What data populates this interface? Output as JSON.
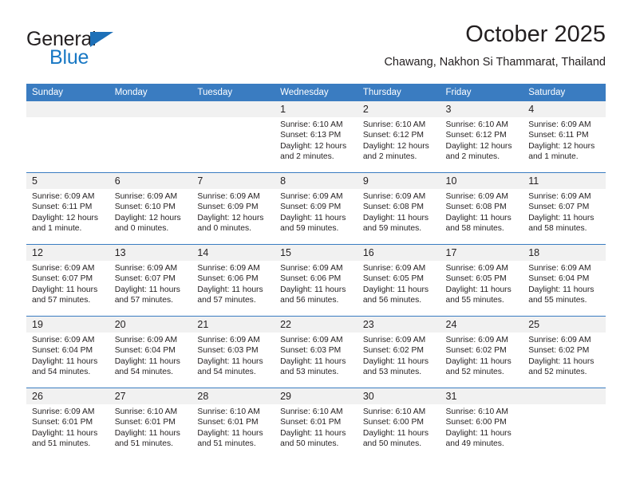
{
  "brand": {
    "name_part1": "General",
    "name_part2": "Blue",
    "triangle_color": "#1d70b8",
    "blue_color": "#1878c4"
  },
  "header": {
    "title": "October 2025",
    "subtitle": "Chawang, Nakhon Si Thammarat, Thailand",
    "header_bg": "#3a7cc1",
    "daynum_bg": "#f1f1f1"
  },
  "weekday_headers": [
    "Sunday",
    "Monday",
    "Tuesday",
    "Wednesday",
    "Thursday",
    "Friday",
    "Saturday"
  ],
  "labels": {
    "sunrise_prefix": "Sunrise:",
    "sunset_prefix": "Sunset:",
    "daylight_prefix": "Daylight:"
  },
  "weeks": [
    [
      {
        "day": "",
        "blank": true
      },
      {
        "day": "",
        "blank": true
      },
      {
        "day": "",
        "blank": true
      },
      {
        "day": "1",
        "sunrise": "Sunrise: 6:10 AM",
        "sunset": "Sunset: 6:13 PM",
        "daylight1": "Daylight: 12 hours",
        "daylight2": "and 2 minutes."
      },
      {
        "day": "2",
        "sunrise": "Sunrise: 6:10 AM",
        "sunset": "Sunset: 6:12 PM",
        "daylight1": "Daylight: 12 hours",
        "daylight2": "and 2 minutes."
      },
      {
        "day": "3",
        "sunrise": "Sunrise: 6:10 AM",
        "sunset": "Sunset: 6:12 PM",
        "daylight1": "Daylight: 12 hours",
        "daylight2": "and 2 minutes."
      },
      {
        "day": "4",
        "sunrise": "Sunrise: 6:09 AM",
        "sunset": "Sunset: 6:11 PM",
        "daylight1": "Daylight: 12 hours",
        "daylight2": "and 1 minute."
      }
    ],
    [
      {
        "day": "5",
        "sunrise": "Sunrise: 6:09 AM",
        "sunset": "Sunset: 6:11 PM",
        "daylight1": "Daylight: 12 hours",
        "daylight2": "and 1 minute."
      },
      {
        "day": "6",
        "sunrise": "Sunrise: 6:09 AM",
        "sunset": "Sunset: 6:10 PM",
        "daylight1": "Daylight: 12 hours",
        "daylight2": "and 0 minutes."
      },
      {
        "day": "7",
        "sunrise": "Sunrise: 6:09 AM",
        "sunset": "Sunset: 6:09 PM",
        "daylight1": "Daylight: 12 hours",
        "daylight2": "and 0 minutes."
      },
      {
        "day": "8",
        "sunrise": "Sunrise: 6:09 AM",
        "sunset": "Sunset: 6:09 PM",
        "daylight1": "Daylight: 11 hours",
        "daylight2": "and 59 minutes."
      },
      {
        "day": "9",
        "sunrise": "Sunrise: 6:09 AM",
        "sunset": "Sunset: 6:08 PM",
        "daylight1": "Daylight: 11 hours",
        "daylight2": "and 59 minutes."
      },
      {
        "day": "10",
        "sunrise": "Sunrise: 6:09 AM",
        "sunset": "Sunset: 6:08 PM",
        "daylight1": "Daylight: 11 hours",
        "daylight2": "and 58 minutes."
      },
      {
        "day": "11",
        "sunrise": "Sunrise: 6:09 AM",
        "sunset": "Sunset: 6:07 PM",
        "daylight1": "Daylight: 11 hours",
        "daylight2": "and 58 minutes."
      }
    ],
    [
      {
        "day": "12",
        "sunrise": "Sunrise: 6:09 AM",
        "sunset": "Sunset: 6:07 PM",
        "daylight1": "Daylight: 11 hours",
        "daylight2": "and 57 minutes."
      },
      {
        "day": "13",
        "sunrise": "Sunrise: 6:09 AM",
        "sunset": "Sunset: 6:07 PM",
        "daylight1": "Daylight: 11 hours",
        "daylight2": "and 57 minutes."
      },
      {
        "day": "14",
        "sunrise": "Sunrise: 6:09 AM",
        "sunset": "Sunset: 6:06 PM",
        "daylight1": "Daylight: 11 hours",
        "daylight2": "and 57 minutes."
      },
      {
        "day": "15",
        "sunrise": "Sunrise: 6:09 AM",
        "sunset": "Sunset: 6:06 PM",
        "daylight1": "Daylight: 11 hours",
        "daylight2": "and 56 minutes."
      },
      {
        "day": "16",
        "sunrise": "Sunrise: 6:09 AM",
        "sunset": "Sunset: 6:05 PM",
        "daylight1": "Daylight: 11 hours",
        "daylight2": "and 56 minutes."
      },
      {
        "day": "17",
        "sunrise": "Sunrise: 6:09 AM",
        "sunset": "Sunset: 6:05 PM",
        "daylight1": "Daylight: 11 hours",
        "daylight2": "and 55 minutes."
      },
      {
        "day": "18",
        "sunrise": "Sunrise: 6:09 AM",
        "sunset": "Sunset: 6:04 PM",
        "daylight1": "Daylight: 11 hours",
        "daylight2": "and 55 minutes."
      }
    ],
    [
      {
        "day": "19",
        "sunrise": "Sunrise: 6:09 AM",
        "sunset": "Sunset: 6:04 PM",
        "daylight1": "Daylight: 11 hours",
        "daylight2": "and 54 minutes."
      },
      {
        "day": "20",
        "sunrise": "Sunrise: 6:09 AM",
        "sunset": "Sunset: 6:04 PM",
        "daylight1": "Daylight: 11 hours",
        "daylight2": "and 54 minutes."
      },
      {
        "day": "21",
        "sunrise": "Sunrise: 6:09 AM",
        "sunset": "Sunset: 6:03 PM",
        "daylight1": "Daylight: 11 hours",
        "daylight2": "and 54 minutes."
      },
      {
        "day": "22",
        "sunrise": "Sunrise: 6:09 AM",
        "sunset": "Sunset: 6:03 PM",
        "daylight1": "Daylight: 11 hours",
        "daylight2": "and 53 minutes."
      },
      {
        "day": "23",
        "sunrise": "Sunrise: 6:09 AM",
        "sunset": "Sunset: 6:02 PM",
        "daylight1": "Daylight: 11 hours",
        "daylight2": "and 53 minutes."
      },
      {
        "day": "24",
        "sunrise": "Sunrise: 6:09 AM",
        "sunset": "Sunset: 6:02 PM",
        "daylight1": "Daylight: 11 hours",
        "daylight2": "and 52 minutes."
      },
      {
        "day": "25",
        "sunrise": "Sunrise: 6:09 AM",
        "sunset": "Sunset: 6:02 PM",
        "daylight1": "Daylight: 11 hours",
        "daylight2": "and 52 minutes."
      }
    ],
    [
      {
        "day": "26",
        "sunrise": "Sunrise: 6:09 AM",
        "sunset": "Sunset: 6:01 PM",
        "daylight1": "Daylight: 11 hours",
        "daylight2": "and 51 minutes."
      },
      {
        "day": "27",
        "sunrise": "Sunrise: 6:10 AM",
        "sunset": "Sunset: 6:01 PM",
        "daylight1": "Daylight: 11 hours",
        "daylight2": "and 51 minutes."
      },
      {
        "day": "28",
        "sunrise": "Sunrise: 6:10 AM",
        "sunset": "Sunset: 6:01 PM",
        "daylight1": "Daylight: 11 hours",
        "daylight2": "and 51 minutes."
      },
      {
        "day": "29",
        "sunrise": "Sunrise: 6:10 AM",
        "sunset": "Sunset: 6:01 PM",
        "daylight1": "Daylight: 11 hours",
        "daylight2": "and 50 minutes."
      },
      {
        "day": "30",
        "sunrise": "Sunrise: 6:10 AM",
        "sunset": "Sunset: 6:00 PM",
        "daylight1": "Daylight: 11 hours",
        "daylight2": "and 50 minutes."
      },
      {
        "day": "31",
        "sunrise": "Sunrise: 6:10 AM",
        "sunset": "Sunset: 6:00 PM",
        "daylight1": "Daylight: 11 hours",
        "daylight2": "and 49 minutes."
      },
      {
        "day": "",
        "blank": true
      }
    ]
  ]
}
